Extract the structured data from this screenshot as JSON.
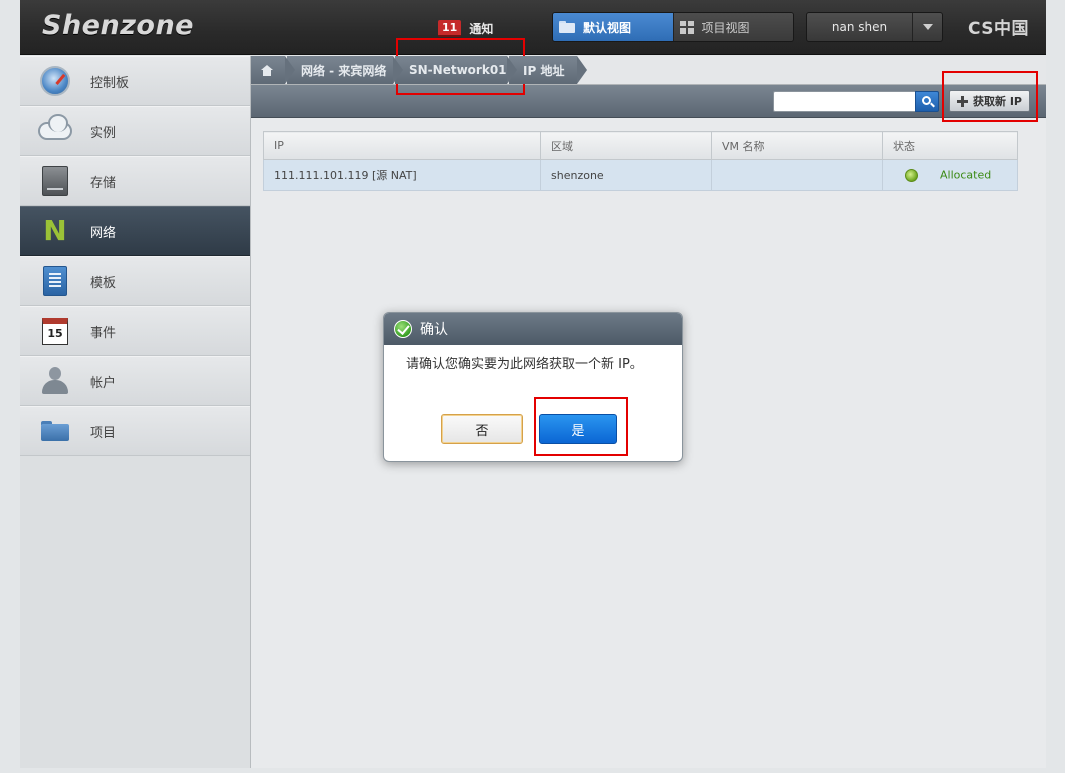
{
  "header": {
    "logo": "Shenzone",
    "notification": {
      "count": "11",
      "label": "通知"
    },
    "views": [
      {
        "label": "默认视图",
        "active": true
      },
      {
        "label": "项目视图",
        "active": false
      }
    ],
    "user": "nan shen",
    "brand": "CS中国"
  },
  "sidebar": {
    "items": [
      {
        "label": "控制板",
        "icon": "dashboard-icon"
      },
      {
        "label": "实例",
        "icon": "cloud-icon"
      },
      {
        "label": "存储",
        "icon": "storage-icon"
      },
      {
        "label": "网络",
        "icon": "network-icon",
        "active": true
      },
      {
        "label": "模板",
        "icon": "template-icon"
      },
      {
        "label": "事件",
        "icon": "calendar-icon",
        "icon_text": "15"
      },
      {
        "label": "帐户",
        "icon": "user-icon"
      },
      {
        "label": "项目",
        "icon": "folder-icon"
      }
    ]
  },
  "breadcrumb": {
    "items": [
      "网络 - 来宾网络",
      "SN-Network01",
      "IP 地址"
    ]
  },
  "toolbar": {
    "search_placeholder": "",
    "add_ip_label": "获取新 IP"
  },
  "table": {
    "columns": [
      "IP",
      "区域",
      "VM 名称",
      "状态"
    ],
    "rows": [
      {
        "ip": "111.111.101.119 [源 NAT]",
        "zone": "shenzone",
        "vm": "",
        "state": "Allocated"
      }
    ]
  },
  "dialog": {
    "title": "确认",
    "message": "请确认您确实要为此网络获取一个新 IP。",
    "no_label": "否",
    "yes_label": "是"
  },
  "colors": {
    "accent": "#0b66d4",
    "annotation": "#e30000",
    "status_ok": "#3b8a14"
  }
}
